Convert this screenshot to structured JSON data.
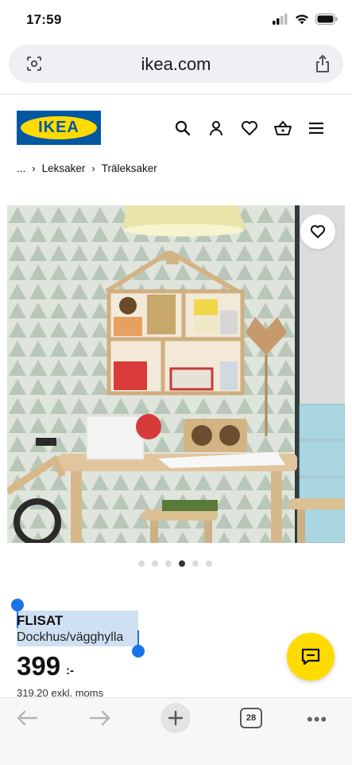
{
  "status": {
    "time": "17:59"
  },
  "browser": {
    "url": "ikea.com",
    "tab_count": "28"
  },
  "header": {
    "logo_text": "IKEA",
    "icons": [
      "search-icon",
      "user-icon",
      "heart-icon",
      "basket-icon",
      "menu-icon"
    ]
  },
  "breadcrumb": {
    "ellipsis": "...",
    "items": [
      "Leksaker",
      "Träleksaker"
    ]
  },
  "gallery": {
    "total_images": 6,
    "active_index": 3
  },
  "product": {
    "name": "FLISAT",
    "description": "Dockhus/vägghylla",
    "price": "399",
    "price_suffix": ":-",
    "price_ex_vat": "319.20 exkl. moms"
  },
  "colors": {
    "ikea_blue": "#0058a3",
    "ikea_yellow": "#ffdb00",
    "selection": "#cfe0f3",
    "selection_handle": "#1a73e8"
  }
}
